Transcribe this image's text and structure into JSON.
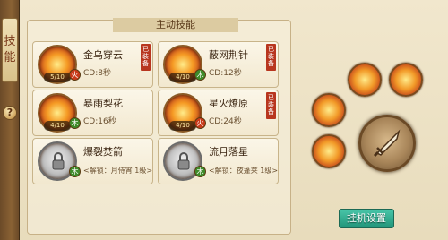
{
  "rail": {
    "tab_label_1": "技",
    "tab_label_2": "能",
    "help_label": "?"
  },
  "panel": {
    "title": "主动技能"
  },
  "skills": [
    {
      "name": "金乌穿云",
      "cd": "CD:8秒",
      "level": "5/10",
      "element": "火",
      "element_type": "fire",
      "equipped": "已装备",
      "locked": false
    },
    {
      "name": "蔽网荆针",
      "cd": "CD:12秒",
      "level": "4/10",
      "element": "木",
      "element_type": "wood",
      "equipped": "已装备",
      "locked": false
    },
    {
      "name": "暴雨梨花",
      "cd": "CD:16秒",
      "level": "4/10",
      "element": "木",
      "element_type": "wood",
      "equipped": "",
      "locked": false
    },
    {
      "name": "星火燎原",
      "cd": "CD:24秒",
      "level": "4/10",
      "element": "火",
      "element_type": "fire",
      "equipped": "已装备",
      "locked": false
    },
    {
      "name": "爆裂焚箭",
      "unlock": "<解锁：月侍宵 1级>",
      "element": "木",
      "element_type": "wood",
      "locked": true
    },
    {
      "name": "流月落星",
      "unlock": "<解锁：夜蓬莱 1级>",
      "element": "木",
      "element_type": "wood",
      "locked": true
    }
  ],
  "auto_button": {
    "label": "挂机设置"
  },
  "colors": {
    "accent": "#22957a",
    "equipped_badge": "#b8361f",
    "fire": "#c83a1a",
    "wood": "#3f8b2a"
  }
}
